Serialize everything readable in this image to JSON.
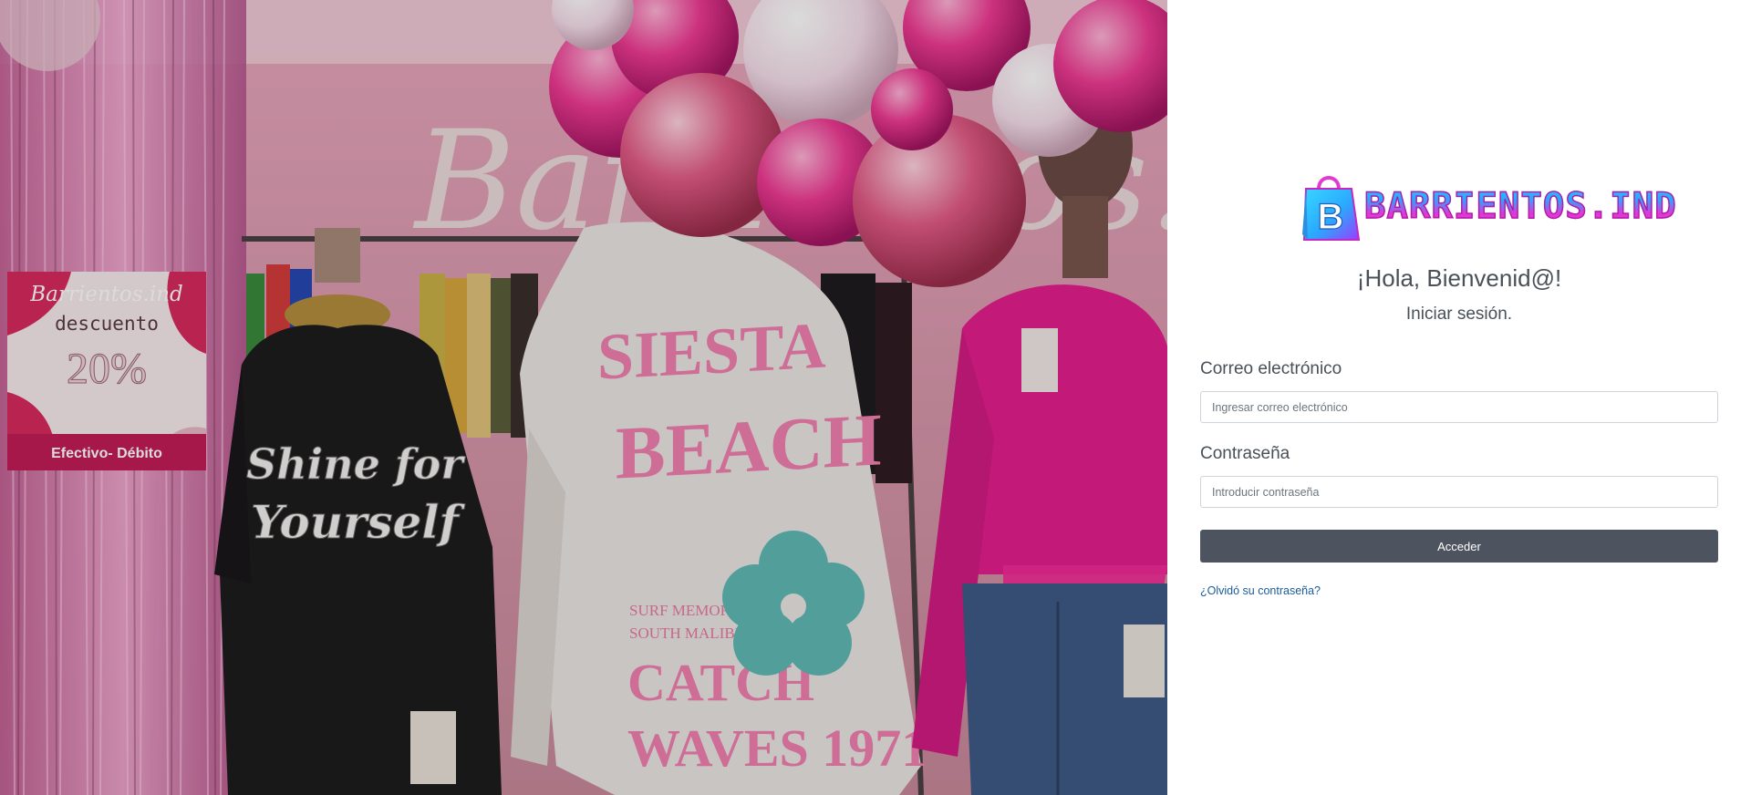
{
  "brand": {
    "logo_text": "BARRIENTOS.IND",
    "logo_icon": "shopping-bag-icon",
    "colors": {
      "cyan": "#3cd7ff",
      "magenta": "#e036d6"
    }
  },
  "hero": {
    "description_icon": "store-photo",
    "sign_text": "Barrientos.ind",
    "promo_sign": {
      "brand": "Barrientos.ind",
      "line1": "descuento",
      "percent": "20%",
      "footer": "Efectivo- Débito"
    },
    "shirt_left_text": [
      "Shine for",
      "Yourself"
    ],
    "hoodie_text": [
      "SIESTA",
      "BEACH",
      "SURF MEMORIES",
      "SOUTH MALIBU",
      "CATCH",
      "WAVES 1971"
    ]
  },
  "login": {
    "greeting": "¡Hola, Bienvenid@!",
    "subtitle": "Iniciar sesión.",
    "email_label": "Correo electrónico",
    "email_placeholder": "Ingresar correo electrónico",
    "email_value": "",
    "password_label": "Contraseña",
    "password_placeholder": "Introducir contraseña",
    "password_value": "",
    "submit_label": "Acceder",
    "forgot_label": "¿Olvidó su contraseña?"
  },
  "colors": {
    "button_bg": "#4e545f",
    "link": "#1a5b9a",
    "text": "#495057"
  }
}
